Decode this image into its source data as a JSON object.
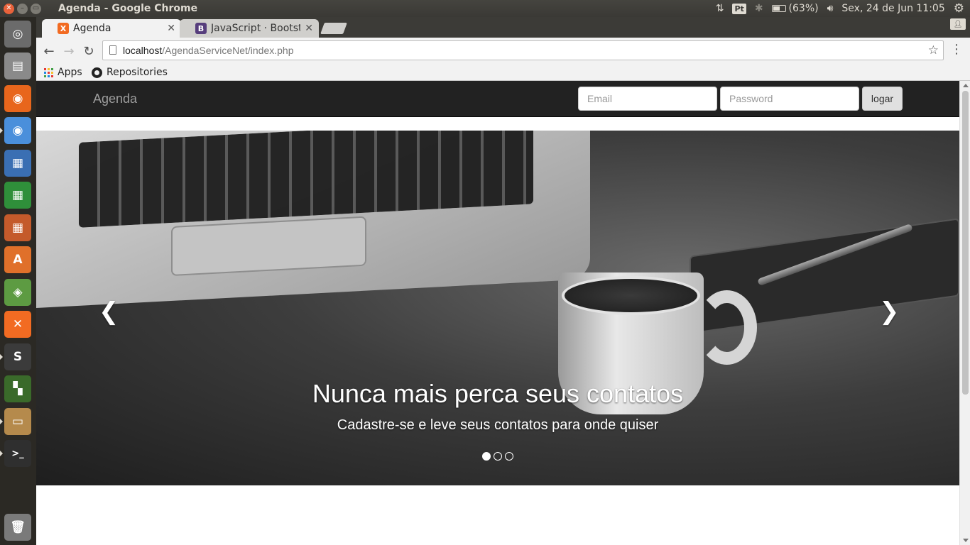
{
  "os": {
    "window_title": "Agenda - Google Chrome",
    "keyboard_layout": "Pt",
    "battery_text": "(63%)",
    "battery_level": 0.63,
    "datetime": "Sex, 24 de Jun 11:05",
    "icons": [
      "network-transfer-icon",
      "bluetooth-icon",
      "battery-icon",
      "volume-icon",
      "settings-gear-icon"
    ]
  },
  "launcher": {
    "items": [
      {
        "name": "dash-icon",
        "glyph": "◎",
        "color": "#6b6b6b"
      },
      {
        "name": "files-icon",
        "glyph": "▤",
        "color": "#8a8a8a"
      },
      {
        "name": "firefox-icon",
        "glyph": "◉",
        "color": "#e8661c"
      },
      {
        "name": "chrome-icon",
        "glyph": "◉",
        "color": "#4a8fdb"
      },
      {
        "name": "writer-icon",
        "glyph": "▦",
        "color": "#3a6fb3"
      },
      {
        "name": "calc-icon",
        "glyph": "▦",
        "color": "#2f8f3a"
      },
      {
        "name": "impress-icon",
        "glyph": "▦",
        "color": "#c45a2b"
      },
      {
        "name": "software-center-icon",
        "glyph": "A",
        "color": "#e0702a"
      },
      {
        "name": "android-studio-icon",
        "glyph": "◈",
        "color": "#5d9b42"
      },
      {
        "name": "xampp-icon",
        "glyph": "✕",
        "color": "#f26b22"
      },
      {
        "name": "sublime-text-icon",
        "glyph": "S",
        "color": "#3b3b3b"
      },
      {
        "name": "windows-app-icon",
        "glyph": "▚",
        "color": "#3a6a2a"
      },
      {
        "name": "archive-icon",
        "glyph": "▭",
        "color": "#b58a4c"
      },
      {
        "name": "terminal-icon",
        "glyph": ">_",
        "color": "#2f2f2f"
      },
      {
        "name": "trash-icon",
        "glyph": "🗑",
        "color": "#7a7a7a"
      }
    ]
  },
  "browser": {
    "tabs": [
      {
        "title": "Agenda",
        "favicon": "X",
        "favicon_color": "#f26b22",
        "active": true
      },
      {
        "title": "JavaScript · Bootstrap",
        "favicon": "B",
        "favicon_color": "#563d7c",
        "active": false
      }
    ],
    "url_host": "localhost",
    "url_path": "/AgendaServiceNet/index.php",
    "bookmarks": [
      "Apps",
      "Repositories"
    ]
  },
  "page": {
    "brand": "Agenda",
    "email_placeholder": "Email",
    "password_placeholder": "Password",
    "login_label": "logar",
    "carousel": {
      "caption_title": "Nunca mais perca seus contatos",
      "caption_text": "Cadastre-se e leve seus contatos para onde quiser",
      "slide_count": 3,
      "active_index": 0,
      "prev_glyph": "❮",
      "next_glyph": "❯"
    }
  }
}
